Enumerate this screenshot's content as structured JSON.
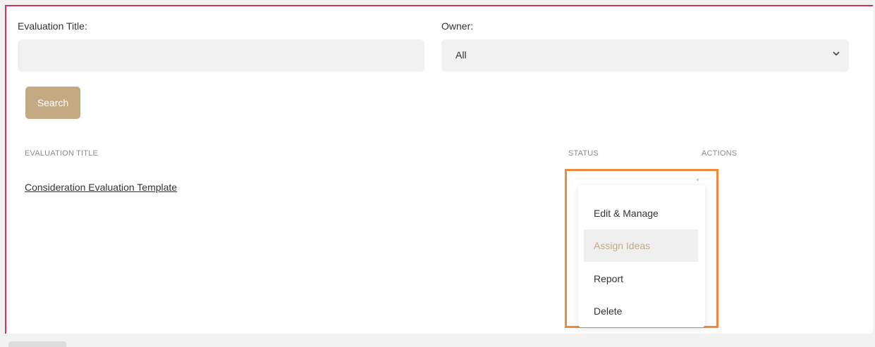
{
  "filters": {
    "title_label": "Evaluation Title:",
    "title_value": "",
    "owner_label": "Owner:",
    "owner_selected": "All"
  },
  "search_button": "Search",
  "table": {
    "columns": [
      "EVALUATION TITLE",
      "STATUS",
      "ACTIONS"
    ],
    "rows": [
      {
        "title": "Consideration Evaluation Template",
        "status": ""
      }
    ]
  },
  "actions_menu": {
    "items": [
      "Edit & Manage",
      "Assign Ideas",
      "Report",
      "Delete"
    ],
    "highlighted_index": 1
  },
  "colors": {
    "accent": "#c4aa83",
    "frame_border": "#d6335a",
    "highlight_outline": "#f08a3c"
  },
  "icons": {
    "owner_dropdown": "chevron-down-icon",
    "actions_caret": "caret-down-icon"
  }
}
